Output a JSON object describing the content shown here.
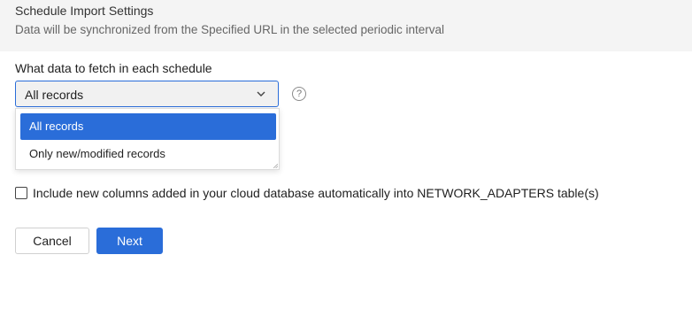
{
  "header": {
    "title": "Schedule Import Settings",
    "subtitle": "Data will be synchronized from the Specified URL in the selected periodic interval"
  },
  "fetch": {
    "label": "What data to fetch in each schedule",
    "selected_value": "All records",
    "help_glyph": "?",
    "options": [
      {
        "label": "All records",
        "selected": true
      },
      {
        "label": "Only new/modified records",
        "selected": false
      }
    ]
  },
  "include_columns": {
    "checked": false,
    "label": "Include new columns added in your cloud database automatically into NETWORK_ADAPTERS table(s)"
  },
  "actions": {
    "cancel_label": "Cancel",
    "next_label": "Next"
  },
  "colors": {
    "accent": "#2a6dd9",
    "header_bg": "#f4f4f4"
  },
  "icons": [
    "chevron-down-icon",
    "help-icon",
    "resize-grip-icon"
  ]
}
